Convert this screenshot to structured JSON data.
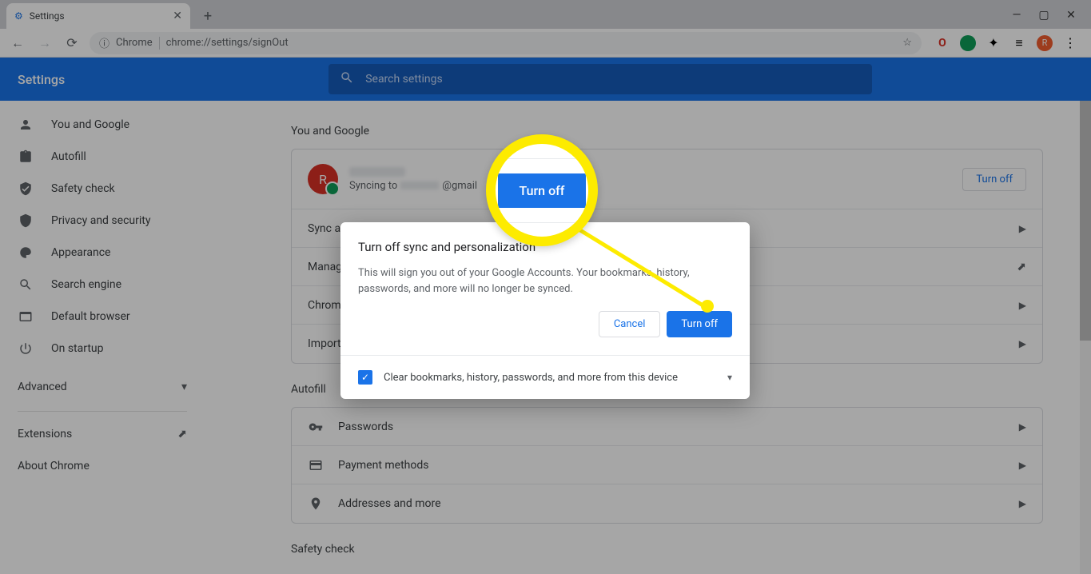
{
  "window": {
    "tab_title": "Settings",
    "url_prefix": "Chrome",
    "url": "chrome://settings/signOut"
  },
  "header": {
    "title": "Settings",
    "search_placeholder": "Search settings"
  },
  "sidebar": {
    "items": [
      {
        "label": "You and Google"
      },
      {
        "label": "Autofill"
      },
      {
        "label": "Safety check"
      },
      {
        "label": "Privacy and security"
      },
      {
        "label": "Appearance"
      },
      {
        "label": "Search engine"
      },
      {
        "label": "Default browser"
      },
      {
        "label": "On startup"
      }
    ],
    "advanced": "Advanced",
    "extensions": "Extensions",
    "about": "About Chrome"
  },
  "main": {
    "you_and_google": {
      "title": "You and Google",
      "avatar_initial": "R",
      "sync_prefix": "Syncing to",
      "email_suffix": "@gmail",
      "turn_off": "Turn off",
      "rows": [
        {
          "label": "Sync a"
        },
        {
          "label": "Manag"
        },
        {
          "label": "Chrom"
        },
        {
          "label": "Import"
        }
      ]
    },
    "autofill": {
      "title": "Autofill",
      "rows": [
        {
          "label": "Passwords"
        },
        {
          "label": "Payment methods"
        },
        {
          "label": "Addresses and more"
        }
      ]
    },
    "safety_check": {
      "title": "Safety check"
    }
  },
  "dialog": {
    "title": "Turn off sync and personalization",
    "body": "This will sign you out of your Google Accounts. Your bookmarks, history, passwords, and more will no longer be synced.",
    "cancel": "Cancel",
    "confirm": "Turn off",
    "checkbox_label": "Clear bookmarks, history, passwords, and more from this device"
  },
  "highlight": {
    "label": "Turn off"
  },
  "avatar_small": "R"
}
